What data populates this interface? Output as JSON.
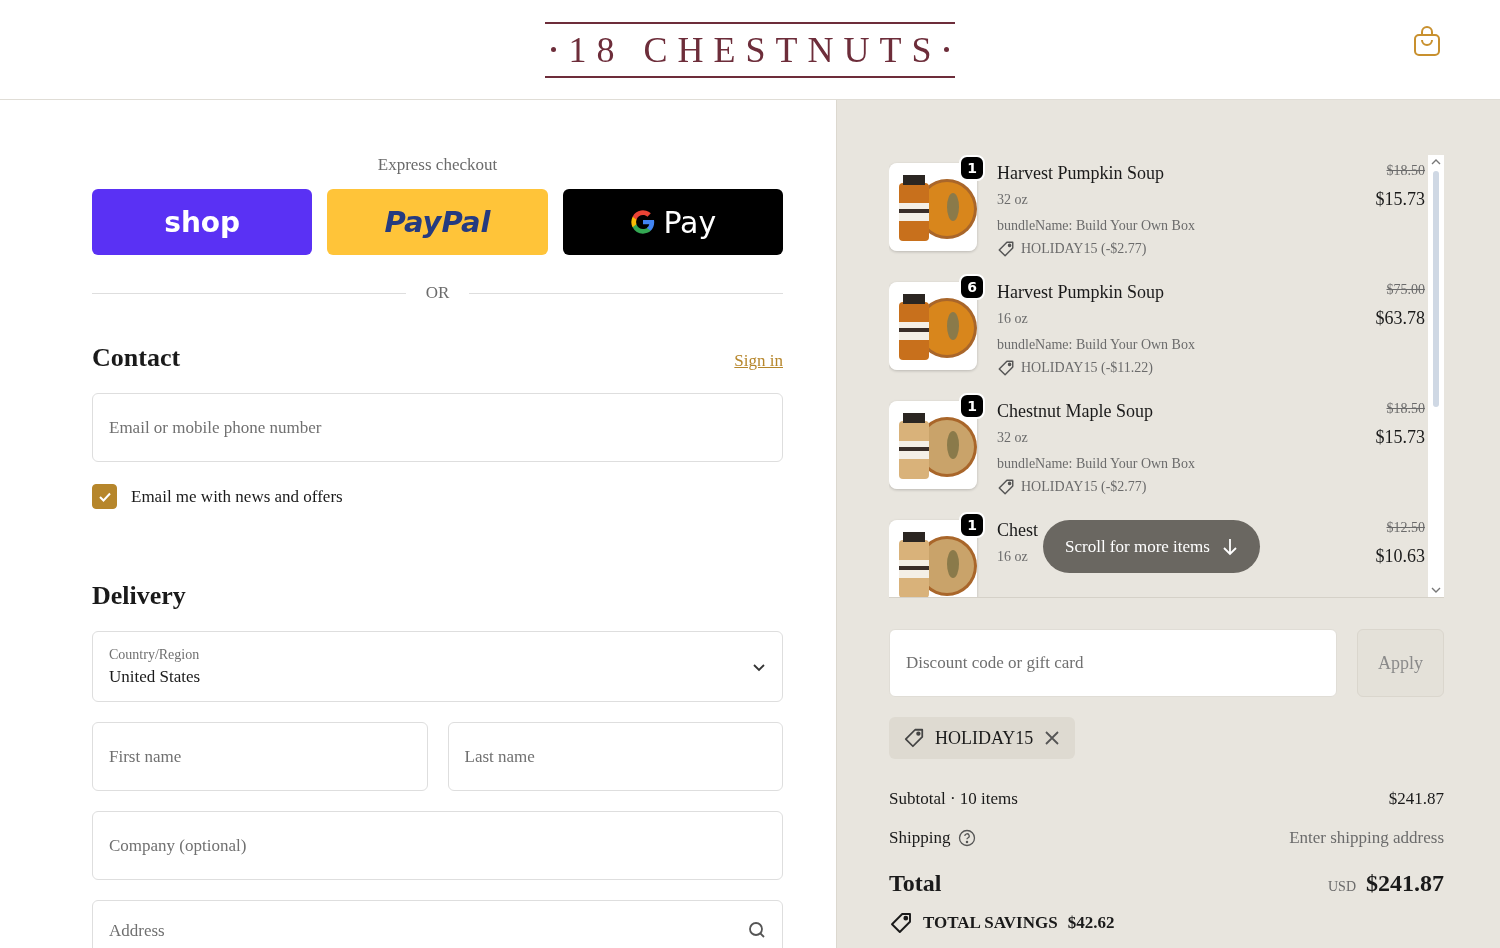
{
  "header": {
    "logo": "18 CHESTNUTS"
  },
  "express_checkout": {
    "title": "Express checkout",
    "buttons": [
      {
        "kind": "shop",
        "label": "shop"
      },
      {
        "kind": "paypal",
        "label": "PayPal"
      },
      {
        "kind": "gpay",
        "label": "Pay"
      }
    ],
    "divider": "OR"
  },
  "contact": {
    "heading": "Contact",
    "sign_in": "Sign in",
    "email": {
      "placeholder": "Email or mobile phone number"
    },
    "newsletter": {
      "label": "Email me with news and offers",
      "checked": true
    }
  },
  "delivery": {
    "heading": "Delivery",
    "country": {
      "label": "Country/Region",
      "value": "United States"
    },
    "first_name": {
      "placeholder": "First name"
    },
    "last_name": {
      "placeholder": "Last name"
    },
    "company": {
      "placeholder": "Company (optional)"
    },
    "address": {
      "placeholder": "Address"
    }
  },
  "order_summary": {
    "items": [
      {
        "quantity": "1",
        "name": "Harvest Pumpkin Soup",
        "variant": "32 oz",
        "bundle": "bundleName: Build Your Own Box",
        "discount": "HOLIDAY15 (-$2.77)",
        "original_price": "$18.50",
        "price": "$15.73"
      },
      {
        "quantity": "6",
        "name": "Harvest Pumpkin Soup",
        "variant": "16 oz",
        "bundle": "bundleName: Build Your Own Box",
        "discount": "HOLIDAY15 (-$11.22)",
        "original_price": "$75.00",
        "price": "$63.78"
      },
      {
        "quantity": "1",
        "name": "Chestnut Maple Soup",
        "variant": "32 oz",
        "bundle": "bundleName: Build Your Own Box",
        "discount": "HOLIDAY15 (-$2.77)",
        "original_price": "$18.50",
        "price": "$15.73"
      },
      {
        "quantity": "1",
        "name": "Chest",
        "variant": "16 oz",
        "original_price": "$12.50",
        "price": "$10.63"
      }
    ],
    "scroll_hint": "Scroll for more items",
    "discount_field": {
      "placeholder": "Discount code or gift card"
    },
    "apply": {
      "label": "Apply",
      "disabled": true
    },
    "applied_code": "HOLIDAY15",
    "subtotal_label": "Subtotal · 10 items",
    "subtotal": "$241.87",
    "shipping_label": "Shipping",
    "shipping_value": "Enter shipping address",
    "total_label": "Total",
    "currency": "USD",
    "total": "$241.87",
    "savings_label": "TOTAL SAVINGS",
    "savings": "$42.62"
  }
}
